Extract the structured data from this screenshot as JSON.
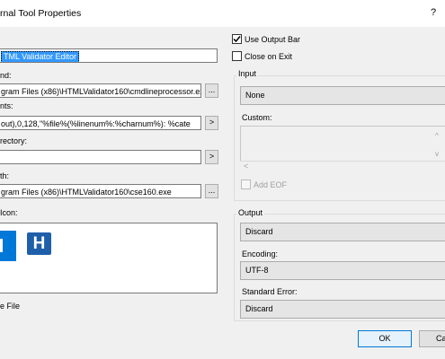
{
  "window": {
    "title": "rnal Tool Properties",
    "help": "?"
  },
  "fields": {
    "title_value": "TML Validator Editor",
    "command_label": "nd:",
    "command_value": "gram Files (x86)\\HTMLValidator160\\cmdlineprocessor.ex",
    "command_browse": "...",
    "arguments_label": "nts:",
    "arguments_value": "out),0,128,\"%file%(%linenum%:%charnum%): %cate",
    "arguments_arrow": ">",
    "directory_label": "rectory:",
    "directory_value": "",
    "directory_arrow": ">",
    "path_label": "th:",
    "path_value": "gram Files (x86)\\HTMLValidator160\\cse160.exe",
    "path_browse": "...",
    "icon_label": "Icon:",
    "icon_letter": "H",
    "save_file_label": "e File"
  },
  "options": {
    "use_output_bar": "Use Output Bar",
    "use_output_bar_checked": true,
    "close_on_exit": "Close on Exit",
    "close_on_exit_checked": false
  },
  "input_group": {
    "label": "Input",
    "value": "None",
    "custom_label": "Custom:",
    "add_eof": "Add EOF"
  },
  "output_group": {
    "label": "Output",
    "value": "Discard",
    "encoding_label": "Encoding:",
    "encoding_value": "UTF-8",
    "stderr_label": "Standard Error:",
    "stderr_value": "Discard"
  },
  "buttons": {
    "ok": "OK",
    "cancel": "Ca"
  },
  "colors": {
    "accent": "#0078d7",
    "selection": "#3399ff",
    "icon_blue": "#1f5faa"
  }
}
